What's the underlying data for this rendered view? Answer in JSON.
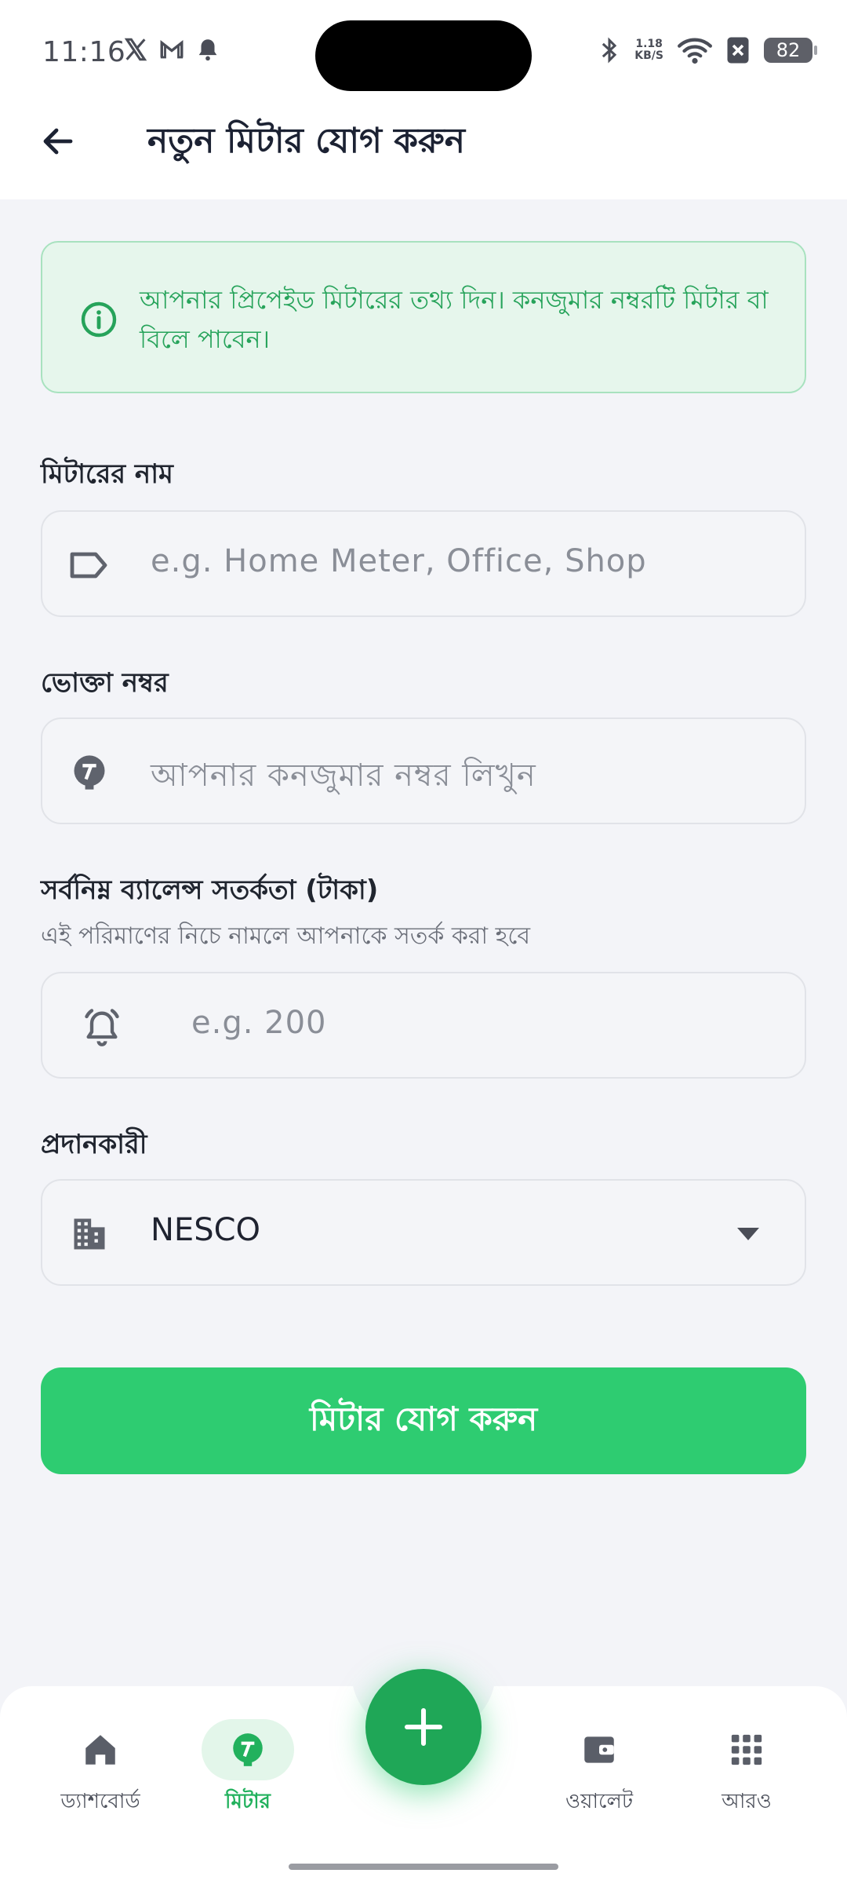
{
  "status_bar": {
    "time": "11:16",
    "network_speed_value": "1.18",
    "network_speed_unit": "KB/S",
    "battery": "82"
  },
  "header": {
    "title": "নতুন মিটার যোগ করুন"
  },
  "info_banner": {
    "text": "আপনার প্রিপেইড মিটারের তথ্য দিন। কনজুমার নম্বরটি মিটার বা বিলে পাবেন।"
  },
  "form": {
    "meter_name": {
      "label": "মিটারের নাম",
      "placeholder": "e.g. Home Meter, Office, Shop",
      "icon": "label-tag-icon"
    },
    "consumer_number": {
      "label": "ভোক্তা নম্বর",
      "placeholder": "আপনার কনজুমার নম্বর লিখুন",
      "icon": "meter-icon"
    },
    "min_balance": {
      "label": "সর্বনিম্ন ব্যালেন্স সতর্কতা (টাকা)",
      "hint": "এই পরিমাণের নিচে নামলে আপনাকে সতর্ক করা হবে",
      "placeholder": "e.g. 200",
      "icon": "alarm-bell-icon"
    },
    "provider": {
      "label": "প্রদানকারী",
      "selected": "NESCO",
      "icon": "building-icon"
    },
    "submit_label": "মিটার যোগ করুন"
  },
  "bottom_nav": {
    "items": [
      {
        "label": "ড্যাশবোর্ড",
        "icon": "home-icon",
        "active": false
      },
      {
        "label": "মিটার",
        "icon": "meter-icon",
        "active": true
      },
      {
        "label": "ওয়ালেট",
        "icon": "wallet-icon",
        "active": false
      },
      {
        "label": "আরও",
        "icon": "grid-icon",
        "active": false
      }
    ],
    "fab_icon": "plus-icon"
  },
  "colors": {
    "accent": "#2ECC71",
    "accent_dark": "#1FA757",
    "info_bg": "#E6F6EC",
    "info_text": "#26A35A"
  }
}
